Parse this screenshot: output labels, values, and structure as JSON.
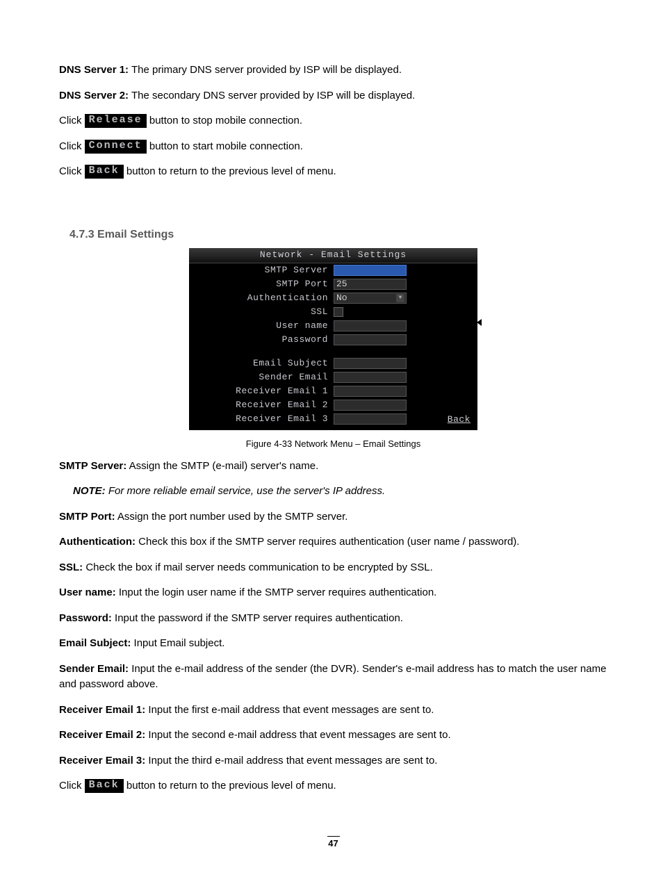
{
  "top": {
    "dns1_label": "DNS Server 1:",
    "dns1_text": " The primary DNS server provided by ISP will be displayed.",
    "dns2_label": "DNS Server 2:",
    "dns2_text": " The secondary DNS server provided by ISP will be displayed.",
    "click": "Click ",
    "release_btn": "Release",
    "release_text": " button to stop mobile connection.",
    "connect_btn": "Connect",
    "connect_text": " button to start mobile connection.",
    "back_btn": "Back",
    "back_text": " button to return to the previous level of menu."
  },
  "section_heading": "4.7.3  Email Settings",
  "figure": {
    "title": "Network - Email Settings",
    "rows": {
      "smtp_server": "SMTP Server",
      "smtp_port": "SMTP Port",
      "smtp_port_val": "25",
      "authentication": "Authentication",
      "authentication_val": "No",
      "ssl": "SSL",
      "user_name": "User name",
      "password": "Password",
      "email_subject": "Email Subject",
      "sender_email": "Sender Email",
      "receiver1": "Receiver Email 1",
      "receiver2": "Receiver Email 2",
      "receiver3": "Receiver Email 3"
    },
    "back": "Back"
  },
  "caption": "Figure 4-33  Network Menu – Email Settings",
  "desc": {
    "smtp_server_l": "SMTP Server:",
    "smtp_server_t": " Assign the SMTP (e-mail) server's name.",
    "note_l": "NOTE:",
    "note_t": " For more reliable email service, use the server's IP address.",
    "smtp_port_l": "SMTP Port:",
    "smtp_port_t": " Assign the port number used by the SMTP server.",
    "auth_l": "Authentication:",
    "auth_t": " Check this box if the SMTP server requires authentication (user name / password).",
    "ssl_l": "SSL:",
    "ssl_t": " Check the box if mail server needs communication to be encrypted by SSL.",
    "user_l": "User name:",
    "user_t": " Input the login user name if the SMTP server requires authentication.",
    "pass_l": "Password:",
    "pass_t": " Input the password if the SMTP server requires authentication.",
    "subj_l": "Email Subject:",
    "subj_t": " Input Email subject.",
    "sender_l": "Sender Email:",
    "sender_t": " Input the e-mail address of the sender (the DVR). Sender's e-mail address has to match the user name and password above.",
    "r1_l": "Receiver Email 1:",
    "r1_t": " Input the first e-mail address that event messages are sent to.",
    "r2_l": "Receiver Email 2:",
    "r2_t": " Input the second e-mail address that event messages are sent to.",
    "r3_l": "Receiver Email 3:",
    "r3_t": " Input the third e-mail address that event messages are sent to.",
    "click": "Click ",
    "back_btn": "Back",
    "back_t": " button to return to the previous level of menu."
  },
  "page_number": "47"
}
